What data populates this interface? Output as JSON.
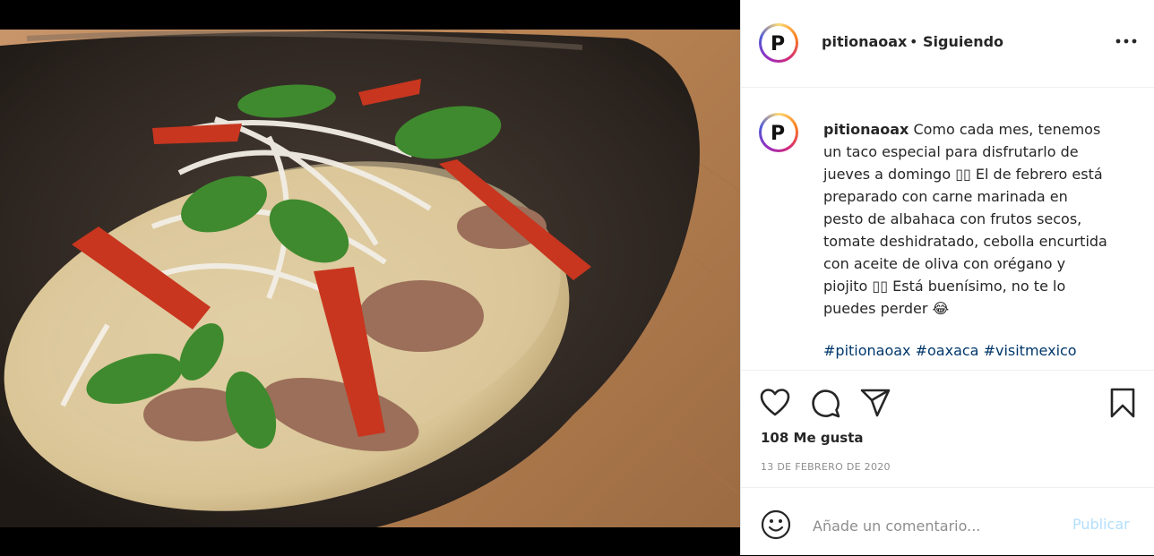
{
  "post": {
    "username": "pitionaoax",
    "separator": "•",
    "follow_status": "Siguiendo",
    "caption_lines": [
      "Como cada mes, tenemos",
      "un taco especial para disfrutarlo de",
      "jueves a domingo ▯▯ El de febrero está",
      "preparado con carne marinada en",
      "pesto de albahaca con frutos secos,",
      "tomate deshidratado, cebolla encurtida",
      "con aceite de oliva con orégano y",
      "piojito ▯▯ Está buenísimo, no te lo",
      "puedes perder 😂"
    ],
    "hashtags": "#pitionaoax #oaxaca #visitmexico",
    "likes": "108 Me gusta",
    "date": "13 DE FEBRERO DE 2020"
  },
  "comment": {
    "placeholder": "Añade un comentario...",
    "publish_label": "Publicar"
  },
  "icons": {
    "more": "more-options-icon",
    "like": "heart-icon",
    "comment": "comment-icon",
    "share": "send-icon",
    "save": "bookmark-icon",
    "emoji": "emoji-icon"
  },
  "colors": {
    "text": "#262626",
    "secondary": "#8e8e8e",
    "hashtag": "#00376b",
    "publish_disabled": "#b2dffc"
  }
}
